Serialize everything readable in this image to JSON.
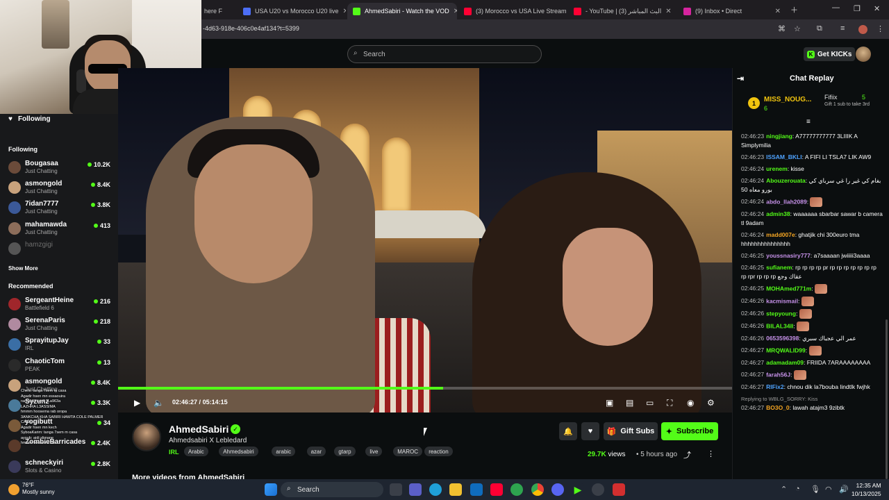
{
  "browser": {
    "tabs": [
      {
        "title": "here F",
        "color": "#8a8a8a"
      },
      {
        "title": "USA U20 vs Morocco U20 live",
        "color": "#4c6ef5"
      },
      {
        "title": "AhmedSabiri - Watch the VOD",
        "color": "#53fc18"
      },
      {
        "title": "(3) Morocco vs USA Live Stream",
        "color": "#ff0033"
      },
      {
        "title": "- YouTube | البث المباشر (3)",
        "color": "#ff0033"
      },
      {
        "title": "(9) Inbox • Direct",
        "color": "#d6249f"
      }
    ],
    "url": "-4d63-918e-406c0e4af134?t=5399"
  },
  "header": {
    "search_placeholder": "Search",
    "get_kicks": "Get KICKs"
  },
  "sidebar": {
    "following_title": "Following",
    "following_heading": "Following",
    "following": [
      {
        "name": "Bougasaa",
        "category": "Just Chatting",
        "viewers": "10.2K",
        "color": "#6b4b3a"
      },
      {
        "name": "asmongold",
        "category": "Just Chatting",
        "viewers": "8.4K",
        "color": "#c8a27c"
      },
      {
        "name": "7idan7777",
        "category": "Just Chatting",
        "viewers": "3.8K",
        "color": "#3b5998"
      },
      {
        "name": "mahamawda",
        "category": "Just Chatting",
        "viewers": "413",
        "color": "#8c6d5a"
      },
      {
        "name": "hamzgigi",
        "category": "",
        "viewers": "",
        "color": "#555555"
      }
    ],
    "show_more": "Show More",
    "recommended_heading": "Recommended",
    "recommended": [
      {
        "name": "SergeantHeine",
        "category": "Battlefield 6",
        "viewers": "216",
        "color": "#a0262b"
      },
      {
        "name": "SerenaParis",
        "category": "Just Chatting",
        "viewers": "218",
        "color": "#b08aa0"
      },
      {
        "name": "SprayitupJay",
        "category": "IRL",
        "viewers": "33",
        "color": "#3a6ea5"
      },
      {
        "name": "ChaoticTom",
        "category": "PEAK",
        "viewers": "13",
        "color": "#2a2a2a"
      },
      {
        "name": "asmongold",
        "category": "Just Chatting",
        "viewers": "8.4K",
        "color": "#c8a27c"
      },
      {
        "name": "Syzunz",
        "category": "",
        "viewers": "3.3K",
        "color": "#4a7a9a"
      },
      {
        "name": "yogibutt",
        "category": "",
        "viewers": "34",
        "color": "#7a5a3a"
      },
      {
        "name": "ZombieBarricades",
        "category": "",
        "viewers": "2.4K",
        "color": "#5a3a2a"
      },
      {
        "name": "schneckyiri",
        "category": "Slots & Casino",
        "viewers": "2.8K",
        "color": "#3a3a5a"
      }
    ],
    "ticker": [
      "Chefs: tanga 7sem m casa",
      "Agadir hsen mn essaouira",
      "rachidda azml : La963a",
      "LAZHRA L3ASSIMA",
      "hmmm hoosema rab oropa",
      "3ANKCHA KHA SABIRI HAWTA COLE PALMER",
      "CASA",
      "Agadir hsen mn kech",
      "SyboaKarim: tanga 7sem m casa",
      "ayoub: aidi slimane",
      "hmmm hoosema rab ..."
    ]
  },
  "player": {
    "current_time": "02:46:27",
    "separator": "/",
    "duration": "05:14:15",
    "progress": 0.529
  },
  "channel": {
    "name": "AhmedSabiri",
    "title": "Ahmedsabiri X Lebledard",
    "category": "IRL",
    "tags": [
      "Arabic",
      "Ahmedsabiri",
      "arabic",
      "azar",
      "gtarp",
      "live",
      "MAROC",
      "reaction"
    ],
    "gift_subs": "Gift Subs",
    "subscribe": "Subscribe",
    "views_value": "29.7K",
    "views_label": "views",
    "ago": "5 hours ago",
    "more_videos": "More videos from AhmedSabiri"
  },
  "chat": {
    "title": "Chat Replay",
    "pinned": {
      "rank": "1",
      "name1": "MISS_NOUG...",
      "count1": "6",
      "name2": "Fifiix",
      "count2": "5",
      "gift": "Gift 1 sub to take 3rd"
    },
    "messages": [
      {
        "time": "02:46:23",
        "user": "ningjiang",
        "color": "#53fc18",
        "text": "A77777777777 3LIIIK A Simplymilia"
      },
      {
        "time": "02:46:23",
        "user": "ISSAM_BKLI",
        "color": "#4fa3ff",
        "text": "A FIFI LI TSLA7 LIK AW9"
      },
      {
        "time": "02:46:24",
        "user": "urenem",
        "color": "#53fc18",
        "text": "kisse"
      },
      {
        "time": "02:46:24",
        "user": "Abouzerouata",
        "color": "#53fc18",
        "text": "بغام كي غير را غي سرباي كي بورو معاه 50"
      },
      {
        "time": "02:46:24",
        "user": "abdo_llah2089",
        "color": "#c792ea",
        "text": ""
      },
      {
        "time": "02:46:24",
        "user": "admin38",
        "color": "#53fc18",
        "text": "waaaaaa sbarbar sawar b camera tl 9adam"
      },
      {
        "time": "02:46:24",
        "user": "madd007e",
        "color": "#f6a623",
        "text": "ghatjik chi 300euro tma hhhhhhhhhhhhhhh"
      },
      {
        "time": "02:46:25",
        "user": "youssnasiry777",
        "color": "#c792ea",
        "text": "a7saaaan jwiiiii3aaaa"
      },
      {
        "time": "02:46:25",
        "user": "sufianem",
        "color": "#53fc18",
        "text": "rp rp rp rp pr rp rp rp rp rp rp rp rp rpr rp rp rp عقاك وجع"
      },
      {
        "time": "02:46:25",
        "user": "MOHAmed771m",
        "color": "#53fc18",
        "text": ""
      },
      {
        "time": "02:46:26",
        "user": "kacmismail",
        "color": "#c792ea",
        "text": ""
      },
      {
        "time": "02:46:26",
        "user": "stepyoung",
        "color": "#53fc18",
        "text": ""
      },
      {
        "time": "02:46:26",
        "user": "BILAL34II",
        "color": "#53fc18",
        "text": ""
      },
      {
        "time": "02:46:26",
        "user": "0653596398",
        "color": "#c792ea",
        "text": "عمر الي عجباك سبري"
      },
      {
        "time": "02:46:27",
        "user": "MRQWALID99",
        "color": "#53fc18",
        "text": ""
      },
      {
        "time": "02:46:27",
        "user": "adamadam09",
        "color": "#53fc18",
        "text": "FRIIDA 7ARAAAAAAAA"
      },
      {
        "time": "02:46:27",
        "user": "farah56J",
        "color": "#c792ea",
        "text": ""
      },
      {
        "time": "02:46:27",
        "user": "RIFix2",
        "color": "#4fa3ff",
        "text": "chnou dik la7bouba lindtlk fwjhk"
      },
      {
        "time": "02:46:27",
        "user": "BO3O_0",
        "color": "#f6a623",
        "text": "lawah atajm3 9zibtk"
      }
    ],
    "reply_note": "Replying to WBLG_SORRY: Kiss"
  },
  "taskbar": {
    "search": "Search",
    "weather_temp": "76°F",
    "weather_desc": "Mostly sunny",
    "time": "12:35 AM",
    "date": "10/13/2025"
  }
}
